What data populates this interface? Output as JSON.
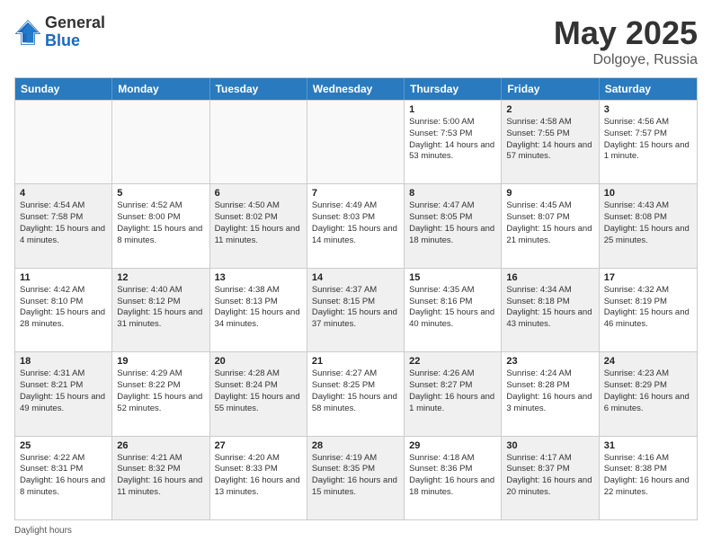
{
  "logo": {
    "general": "General",
    "blue": "Blue"
  },
  "title": {
    "month": "May 2025",
    "location": "Dolgoye, Russia"
  },
  "header_days": [
    "Sunday",
    "Monday",
    "Tuesday",
    "Wednesday",
    "Thursday",
    "Friday",
    "Saturday"
  ],
  "footer": "Daylight hours",
  "weeks": [
    [
      {
        "day": "",
        "sunrise": "",
        "sunset": "",
        "daylight": "",
        "shaded": false,
        "empty": true
      },
      {
        "day": "",
        "sunrise": "",
        "sunset": "",
        "daylight": "",
        "shaded": false,
        "empty": true
      },
      {
        "day": "",
        "sunrise": "",
        "sunset": "",
        "daylight": "",
        "shaded": false,
        "empty": true
      },
      {
        "day": "",
        "sunrise": "",
        "sunset": "",
        "daylight": "",
        "shaded": false,
        "empty": true
      },
      {
        "day": "1",
        "sunrise": "Sunrise: 5:00 AM",
        "sunset": "Sunset: 7:53 PM",
        "daylight": "Daylight: 14 hours and 53 minutes.",
        "shaded": false,
        "empty": false
      },
      {
        "day": "2",
        "sunrise": "Sunrise: 4:58 AM",
        "sunset": "Sunset: 7:55 PM",
        "daylight": "Daylight: 14 hours and 57 minutes.",
        "shaded": true,
        "empty": false
      },
      {
        "day": "3",
        "sunrise": "Sunrise: 4:56 AM",
        "sunset": "Sunset: 7:57 PM",
        "daylight": "Daylight: 15 hours and 1 minute.",
        "shaded": false,
        "empty": false
      }
    ],
    [
      {
        "day": "4",
        "sunrise": "Sunrise: 4:54 AM",
        "sunset": "Sunset: 7:58 PM",
        "daylight": "Daylight: 15 hours and 4 minutes.",
        "shaded": true,
        "empty": false
      },
      {
        "day": "5",
        "sunrise": "Sunrise: 4:52 AM",
        "sunset": "Sunset: 8:00 PM",
        "daylight": "Daylight: 15 hours and 8 minutes.",
        "shaded": false,
        "empty": false
      },
      {
        "day": "6",
        "sunrise": "Sunrise: 4:50 AM",
        "sunset": "Sunset: 8:02 PM",
        "daylight": "Daylight: 15 hours and 11 minutes.",
        "shaded": true,
        "empty": false
      },
      {
        "day": "7",
        "sunrise": "Sunrise: 4:49 AM",
        "sunset": "Sunset: 8:03 PM",
        "daylight": "Daylight: 15 hours and 14 minutes.",
        "shaded": false,
        "empty": false
      },
      {
        "day": "8",
        "sunrise": "Sunrise: 4:47 AM",
        "sunset": "Sunset: 8:05 PM",
        "daylight": "Daylight: 15 hours and 18 minutes.",
        "shaded": true,
        "empty": false
      },
      {
        "day": "9",
        "sunrise": "Sunrise: 4:45 AM",
        "sunset": "Sunset: 8:07 PM",
        "daylight": "Daylight: 15 hours and 21 minutes.",
        "shaded": false,
        "empty": false
      },
      {
        "day": "10",
        "sunrise": "Sunrise: 4:43 AM",
        "sunset": "Sunset: 8:08 PM",
        "daylight": "Daylight: 15 hours and 25 minutes.",
        "shaded": true,
        "empty": false
      }
    ],
    [
      {
        "day": "11",
        "sunrise": "Sunrise: 4:42 AM",
        "sunset": "Sunset: 8:10 PM",
        "daylight": "Daylight: 15 hours and 28 minutes.",
        "shaded": false,
        "empty": false
      },
      {
        "day": "12",
        "sunrise": "Sunrise: 4:40 AM",
        "sunset": "Sunset: 8:12 PM",
        "daylight": "Daylight: 15 hours and 31 minutes.",
        "shaded": true,
        "empty": false
      },
      {
        "day": "13",
        "sunrise": "Sunrise: 4:38 AM",
        "sunset": "Sunset: 8:13 PM",
        "daylight": "Daylight: 15 hours and 34 minutes.",
        "shaded": false,
        "empty": false
      },
      {
        "day": "14",
        "sunrise": "Sunrise: 4:37 AM",
        "sunset": "Sunset: 8:15 PM",
        "daylight": "Daylight: 15 hours and 37 minutes.",
        "shaded": true,
        "empty": false
      },
      {
        "day": "15",
        "sunrise": "Sunrise: 4:35 AM",
        "sunset": "Sunset: 8:16 PM",
        "daylight": "Daylight: 15 hours and 40 minutes.",
        "shaded": false,
        "empty": false
      },
      {
        "day": "16",
        "sunrise": "Sunrise: 4:34 AM",
        "sunset": "Sunset: 8:18 PM",
        "daylight": "Daylight: 15 hours and 43 minutes.",
        "shaded": true,
        "empty": false
      },
      {
        "day": "17",
        "sunrise": "Sunrise: 4:32 AM",
        "sunset": "Sunset: 8:19 PM",
        "daylight": "Daylight: 15 hours and 46 minutes.",
        "shaded": false,
        "empty": false
      }
    ],
    [
      {
        "day": "18",
        "sunrise": "Sunrise: 4:31 AM",
        "sunset": "Sunset: 8:21 PM",
        "daylight": "Daylight: 15 hours and 49 minutes.",
        "shaded": true,
        "empty": false
      },
      {
        "day": "19",
        "sunrise": "Sunrise: 4:29 AM",
        "sunset": "Sunset: 8:22 PM",
        "daylight": "Daylight: 15 hours and 52 minutes.",
        "shaded": false,
        "empty": false
      },
      {
        "day": "20",
        "sunrise": "Sunrise: 4:28 AM",
        "sunset": "Sunset: 8:24 PM",
        "daylight": "Daylight: 15 hours and 55 minutes.",
        "shaded": true,
        "empty": false
      },
      {
        "day": "21",
        "sunrise": "Sunrise: 4:27 AM",
        "sunset": "Sunset: 8:25 PM",
        "daylight": "Daylight: 15 hours and 58 minutes.",
        "shaded": false,
        "empty": false
      },
      {
        "day": "22",
        "sunrise": "Sunrise: 4:26 AM",
        "sunset": "Sunset: 8:27 PM",
        "daylight": "Daylight: 16 hours and 1 minute.",
        "shaded": true,
        "empty": false
      },
      {
        "day": "23",
        "sunrise": "Sunrise: 4:24 AM",
        "sunset": "Sunset: 8:28 PM",
        "daylight": "Daylight: 16 hours and 3 minutes.",
        "shaded": false,
        "empty": false
      },
      {
        "day": "24",
        "sunrise": "Sunrise: 4:23 AM",
        "sunset": "Sunset: 8:29 PM",
        "daylight": "Daylight: 16 hours and 6 minutes.",
        "shaded": true,
        "empty": false
      }
    ],
    [
      {
        "day": "25",
        "sunrise": "Sunrise: 4:22 AM",
        "sunset": "Sunset: 8:31 PM",
        "daylight": "Daylight: 16 hours and 8 minutes.",
        "shaded": false,
        "empty": false
      },
      {
        "day": "26",
        "sunrise": "Sunrise: 4:21 AM",
        "sunset": "Sunset: 8:32 PM",
        "daylight": "Daylight: 16 hours and 11 minutes.",
        "shaded": true,
        "empty": false
      },
      {
        "day": "27",
        "sunrise": "Sunrise: 4:20 AM",
        "sunset": "Sunset: 8:33 PM",
        "daylight": "Daylight: 16 hours and 13 minutes.",
        "shaded": false,
        "empty": false
      },
      {
        "day": "28",
        "sunrise": "Sunrise: 4:19 AM",
        "sunset": "Sunset: 8:35 PM",
        "daylight": "Daylight: 16 hours and 15 minutes.",
        "shaded": true,
        "empty": false
      },
      {
        "day": "29",
        "sunrise": "Sunrise: 4:18 AM",
        "sunset": "Sunset: 8:36 PM",
        "daylight": "Daylight: 16 hours and 18 minutes.",
        "shaded": false,
        "empty": false
      },
      {
        "day": "30",
        "sunrise": "Sunrise: 4:17 AM",
        "sunset": "Sunset: 8:37 PM",
        "daylight": "Daylight: 16 hours and 20 minutes.",
        "shaded": true,
        "empty": false
      },
      {
        "day": "31",
        "sunrise": "Sunrise: 4:16 AM",
        "sunset": "Sunset: 8:38 PM",
        "daylight": "Daylight: 16 hours and 22 minutes.",
        "shaded": false,
        "empty": false
      }
    ]
  ]
}
